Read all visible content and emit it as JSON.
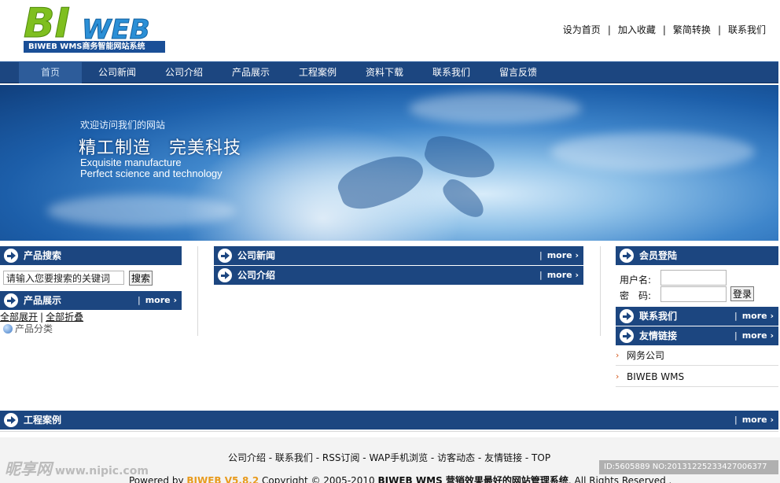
{
  "logo": {
    "part1": "BI",
    "part2": "WEB",
    "tagline": "BIWEB WMS商务智能网站系统"
  },
  "toplinks": [
    "设为首页",
    "加入收藏",
    "繁简转换",
    "联系我们"
  ],
  "nav": [
    "首页",
    "公司新闻",
    "公司介绍",
    "产品展示",
    "工程案例",
    "资料下载",
    "联系我们",
    "留言反馈"
  ],
  "banner": {
    "welcome": "欢迎访问我们的网站",
    "title": "精工制造　完美科技",
    "en1": "Exquisite manufacture",
    "en2": "Perfect science and technology"
  },
  "more": "more ›",
  "sections": {
    "product_search": "产品搜索",
    "product_show": "产品展示",
    "company_news": "公司新闻",
    "company_intro": "公司介绍",
    "member_login": "会员登陆",
    "contact_us": "联系我们",
    "friend_links": "友情链接",
    "projects": "工程案例"
  },
  "search": {
    "value": "请输入您要搜索的关键词",
    "button": "搜索"
  },
  "tree": {
    "expand": "全部展开",
    "sep": "|",
    "collapse": "全部折叠",
    "category": "产品分类"
  },
  "login": {
    "username_label": "用户名:",
    "password_label": "密　码:",
    "button": "登录"
  },
  "friend_links": [
    "网务公司",
    "BIWEB WMS"
  ],
  "footer": {
    "links": [
      "公司介绍",
      "联系我们",
      "RSS订阅",
      "WAP手机浏览",
      "访客动态",
      "友情链接",
      "TOP"
    ],
    "copy_prefix": "Powered by ",
    "brand": "BIWEB V5.8.2",
    "copy_mid": " Copyright © 2005-2010 ",
    "copy_bold": "BIWEB WMS 营销效果最好的网站管理系统",
    "copy_suffix": ". All Rights Reserved ."
  },
  "watermark": {
    "text": "昵享网",
    "url": "www.nipic.com"
  },
  "id_tag": "ID:5605889 NO:20131225233427006377"
}
